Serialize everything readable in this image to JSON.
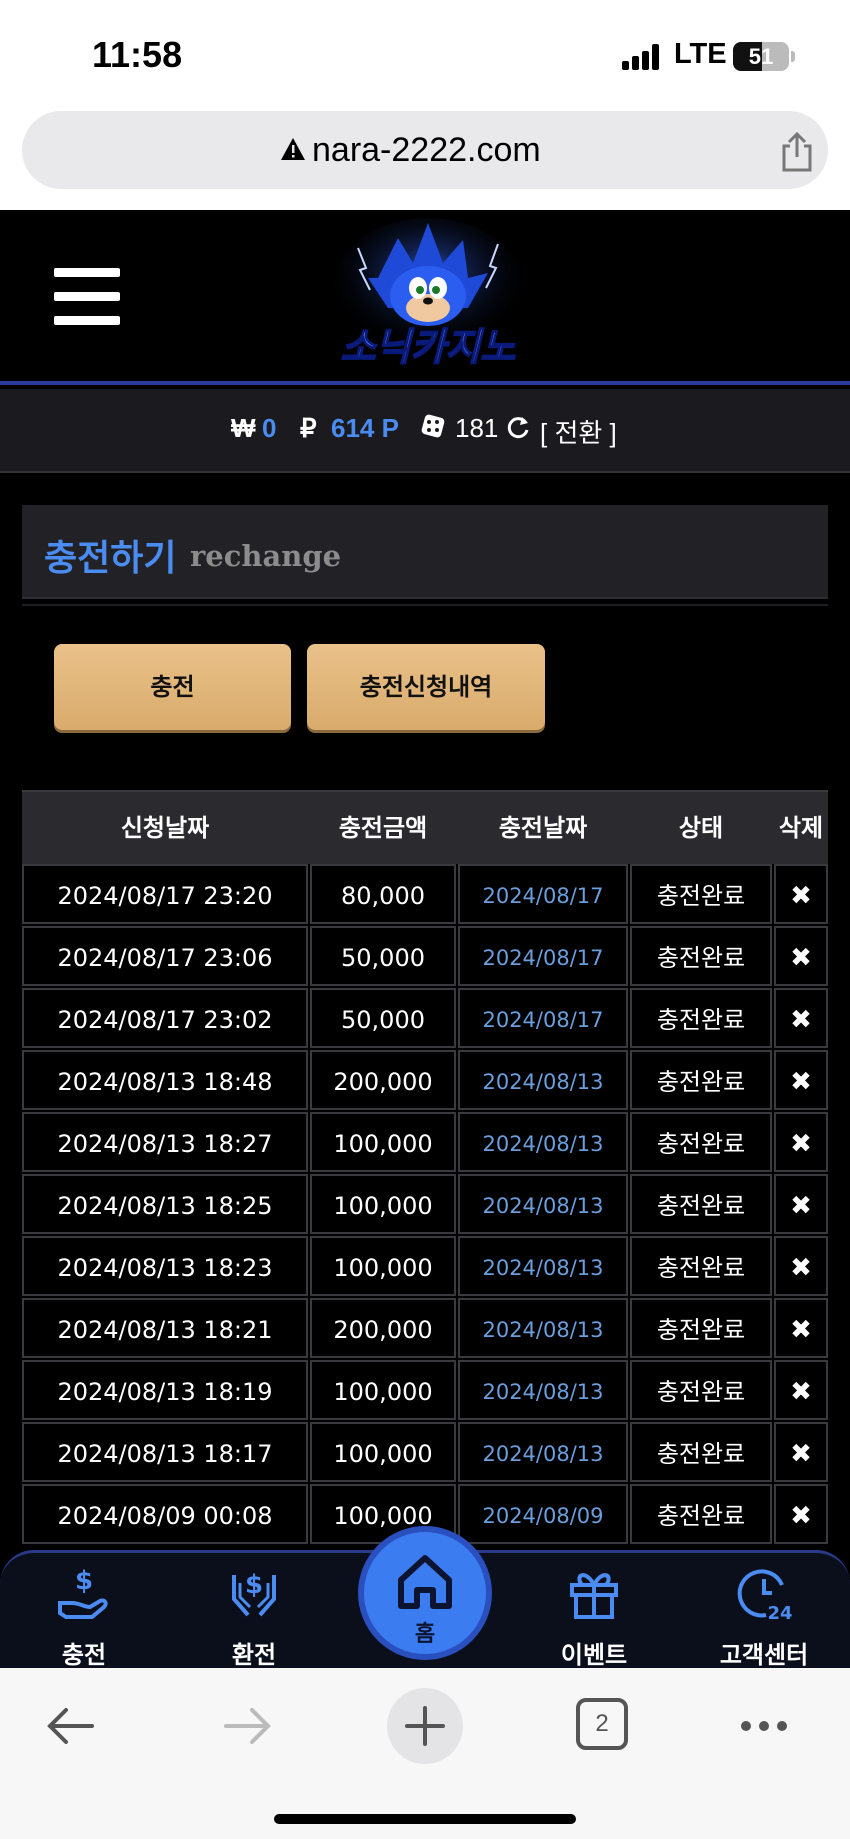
{
  "status": {
    "time": "11:58",
    "network": "LTE",
    "battery": "51",
    "battery_level": 0.51
  },
  "browser": {
    "url": "nara-2222.com",
    "tab_count": "2"
  },
  "header": {
    "logo_text": "소닉카지노"
  },
  "balance": {
    "won_symbol": "₩",
    "won": "0",
    "point_symbol": "₽",
    "points": "614 P",
    "dice": "181",
    "convert": "[ 전환 ]"
  },
  "section": {
    "title_ko": "충전하기",
    "title_en": "rechange"
  },
  "buttons": {
    "charge": "충전",
    "history": "충전신청내역"
  },
  "table": {
    "headers": [
      "신청날짜",
      "충전금액",
      "충전날짜",
      "상태",
      "삭제"
    ],
    "rows": [
      [
        "2024/08/17 23:20",
        "80,000",
        "2024/08/17",
        "충전완료",
        "✖"
      ],
      [
        "2024/08/17 23:06",
        "50,000",
        "2024/08/17",
        "충전완료",
        "✖"
      ],
      [
        "2024/08/17 23:02",
        "50,000",
        "2024/08/17",
        "충전완료",
        "✖"
      ],
      [
        "2024/08/13 18:48",
        "200,000",
        "2024/08/13",
        "충전완료",
        "✖"
      ],
      [
        "2024/08/13 18:27",
        "100,000",
        "2024/08/13",
        "충전완료",
        "✖"
      ],
      [
        "2024/08/13 18:25",
        "100,000",
        "2024/08/13",
        "충전완료",
        "✖"
      ],
      [
        "2024/08/13 18:23",
        "100,000",
        "2024/08/13",
        "충전완료",
        "✖"
      ],
      [
        "2024/08/13 18:21",
        "200,000",
        "2024/08/13",
        "충전완료",
        "✖"
      ],
      [
        "2024/08/13 18:19",
        "100,000",
        "2024/08/13",
        "충전완료",
        "✖"
      ],
      [
        "2024/08/13 18:17",
        "100,000",
        "2024/08/13",
        "충전완료",
        "✖"
      ],
      [
        "2024/08/09 00:08",
        "100,000",
        "2024/08/09",
        "충전완료",
        "✖"
      ]
    ]
  },
  "bottom_nav": {
    "charge": "충전",
    "exchange": "환전",
    "home": "홈",
    "event": "이벤트",
    "support": "고객센터"
  },
  "colors": {
    "accent": "#4a8cf2",
    "gold": "#e2b77a",
    "date_blue": "#6a9edc",
    "nav_blue": "#3b7df0"
  },
  "icons": [
    "warning-icon",
    "share-icon",
    "hamburger-icon",
    "dice-icon",
    "refresh-icon",
    "charge-icon",
    "exchange-icon",
    "home-icon",
    "gift-icon",
    "support-24-icon",
    "back-icon",
    "forward-icon",
    "new-tab-icon",
    "more-icon"
  ]
}
